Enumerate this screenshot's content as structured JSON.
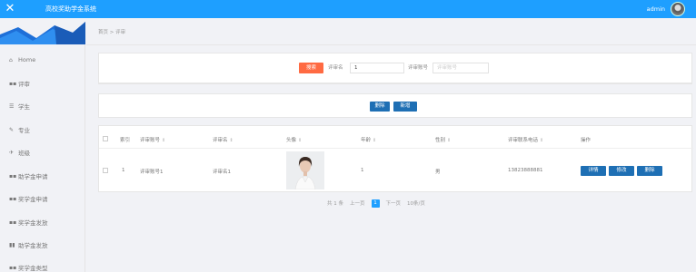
{
  "header": {
    "title": "高校奖助学金系统",
    "username": "admin",
    "colors": {
      "bar": "#1e9fff"
    }
  },
  "sidebar": {
    "items": [
      {
        "label": "Home",
        "icon": "home-icon"
      },
      {
        "label": "评审",
        "icon": "grid-icon"
      },
      {
        "label": "学生",
        "icon": "list-icon"
      },
      {
        "label": "专业",
        "icon": "thumb-icon"
      },
      {
        "label": "班级",
        "icon": "pin-icon"
      },
      {
        "label": "助学金申请",
        "icon": "grid-icon"
      },
      {
        "label": "奖学金申请",
        "icon": "grid-icon"
      },
      {
        "label": "奖学金发放",
        "icon": "grid-icon"
      },
      {
        "label": "助学金发放",
        "icon": "bars-icon"
      },
      {
        "label": "奖学金类型",
        "icon": "grid-icon"
      }
    ]
  },
  "breadcrumb": "首页 > 评审",
  "search": {
    "button": "搜索",
    "name_label": "评审名",
    "name_value": "1",
    "account_label": "评审账号",
    "account_placeholder": "评审账号"
  },
  "actions": {
    "delete": "删除",
    "add": "新增"
  },
  "table": {
    "headers": [
      "索引",
      "评审账号",
      "评审名",
      "头像",
      "年龄",
      "性别",
      "评审联系电话",
      "操作"
    ],
    "rows": [
      {
        "index": "1",
        "account": "评审账号1",
        "name": "评审名1",
        "age": "1",
        "gender": "男",
        "phone": "13823888881",
        "ops": [
          "详情",
          "修改",
          "删除"
        ]
      }
    ]
  },
  "pagination": {
    "total": "共 1 条",
    "prev": "上一页",
    "current": "1",
    "next": "下一页",
    "per_page": "10条/页"
  }
}
